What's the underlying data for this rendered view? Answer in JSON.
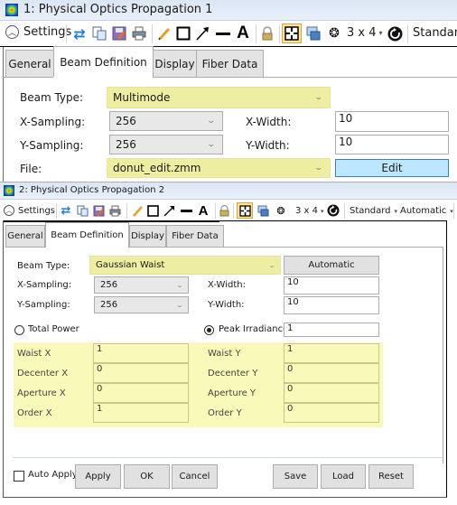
{
  "window1": {
    "title": "1: Physical Optics Propagation 1",
    "toolbar": {
      "settings_label": "Settings",
      "layout_label": "3 x 4",
      "layout_arrow": "▾",
      "standard_label": "Standard"
    },
    "tabs": [
      {
        "label": "General",
        "active": false
      },
      {
        "label": "Beam Definition",
        "active": true
      },
      {
        "label": "Display",
        "active": false
      },
      {
        "label": "Fiber Data",
        "active": false
      }
    ],
    "form": {
      "beam_type_label": "Beam Type:",
      "beam_type_value": "Multimode",
      "x_sampling_label": "X-Sampling:",
      "x_sampling_value": "256",
      "y_sampling_label": "Y-Sampling:",
      "y_sampling_value": "256",
      "x_width_label": "X-Width:",
      "x_width_value": "10",
      "y_width_label": "Y-Width:",
      "y_width_value": "10",
      "file_label": "File:",
      "file_value": "donut_edit.zmm",
      "edit_button": "Edit"
    }
  },
  "window2": {
    "title": "2: Physical Optics Propagation 2",
    "toolbar": {
      "settings_label": "Settings",
      "layout_label": "3 x 4",
      "layout_arrow": "▾",
      "standard_label": "Standard",
      "standard_arrow": "▾",
      "automatic_label": "Automatic",
      "automatic_arrow": "▾"
    },
    "tabs": [
      {
        "label": "General",
        "active": false
      },
      {
        "label": "Beam Definition",
        "active": true
      },
      {
        "label": "Display",
        "active": false
      },
      {
        "label": "Fiber Data",
        "active": false
      }
    ],
    "form": {
      "beam_type_label": "Beam Type:",
      "beam_type_value": "Gaussian Waist",
      "automatic_button": "Automatic",
      "x_sampling_label": "X-Sampling:",
      "x_sampling_value": "256",
      "y_sampling_label": "Y-Sampling:",
      "y_sampling_value": "256",
      "x_width_label": "X-Width:",
      "x_width_value": "10",
      "y_width_label": "Y-Width:",
      "y_width_value": "10",
      "total_power_label": "Total Power",
      "total_power_selected": false,
      "peak_irradiance_label": "Peak Irradiance",
      "peak_irradiance_selected": true,
      "peak_irradiance_value": "1",
      "params": [
        {
          "x_label": "Waist X",
          "x_value": "1",
          "y_label": "Waist Y",
          "y_value": "1"
        },
        {
          "x_label": "Decenter X",
          "x_value": "0",
          "y_label": "Decenter Y",
          "y_value": "0"
        },
        {
          "x_label": "Aperture X",
          "x_value": "0",
          "y_label": "Aperture Y",
          "y_value": "0"
        },
        {
          "x_label": "Order X",
          "x_value": "1",
          "y_label": "Order Y",
          "y_value": "0"
        }
      ]
    },
    "footer": {
      "auto_apply_label": "Auto Apply",
      "auto_apply_checked": false,
      "apply": "Apply",
      "ok": "OK",
      "cancel": "Cancel",
      "save": "Save",
      "load": "Load",
      "reset": "Reset"
    }
  },
  "colors": {
    "highlight_yellow": "#eeeea2",
    "panel_yellow": "#f9f9b9",
    "edit_button_blue": "#bee6fd",
    "titlebar": "#dbe6f4"
  }
}
